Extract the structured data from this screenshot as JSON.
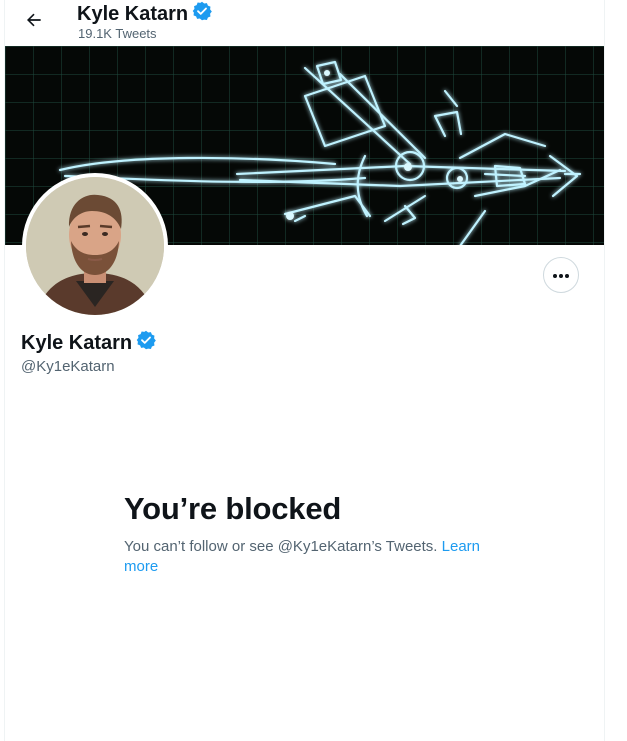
{
  "header": {
    "back_icon": "arrow-left-icon",
    "name": "Kyle Katarn",
    "tweet_count": "19.1K Tweets"
  },
  "profile": {
    "name": "Kyle Katarn",
    "handle": "@Ky1eKatarn",
    "verified_icon": "verified-badge-icon",
    "more_icon": "more-dots-icon"
  },
  "blocked": {
    "title": "You’re blocked",
    "message": "You can’t follow or see @Ky1eKatarn’s Tweets. ",
    "learn_more": "Learn more"
  },
  "colors": {
    "accent": "#1d9bf0",
    "text_primary": "#0f1419",
    "text_secondary": "#536471",
    "banner_glow": "#8fe3ff"
  }
}
